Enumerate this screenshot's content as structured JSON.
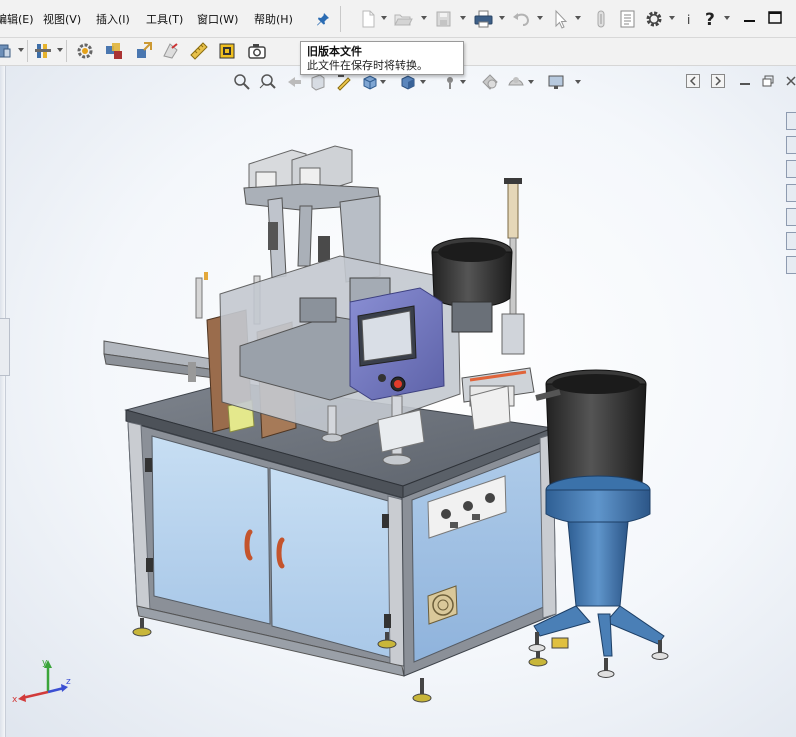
{
  "menus": [
    {
      "label": "编辑(E)"
    },
    {
      "label": "视图(V)"
    },
    {
      "label": "插入(I)"
    },
    {
      "label": "工具(T)"
    },
    {
      "label": "窗口(W)"
    },
    {
      "label": "帮助(H)"
    }
  ],
  "toolbar_icons": [
    "new-document-icon",
    "open-folder-icon",
    "save-icon",
    "print-icon",
    "undo-icon",
    "select-pointer-icon",
    "rebuild-icon",
    "file-properties-icon",
    "options-gear-icon",
    "help-icon"
  ],
  "tooltip": {
    "title": "旧版本文件",
    "description": "此文件在保存时将转换。"
  },
  "colors": {
    "menubar_bg": "#f2f2f2",
    "viewport_bg": "#eef2f7",
    "cabinet_blue": "#b8d4ee",
    "frame_gray": "#7a7e86",
    "feeder_blue": "#3f78b0",
    "pin_blue": "#2b6cb3"
  },
  "triad": {
    "x": "x",
    "y": "y",
    "z": "z"
  },
  "labels": {
    "window_more": "i"
  }
}
